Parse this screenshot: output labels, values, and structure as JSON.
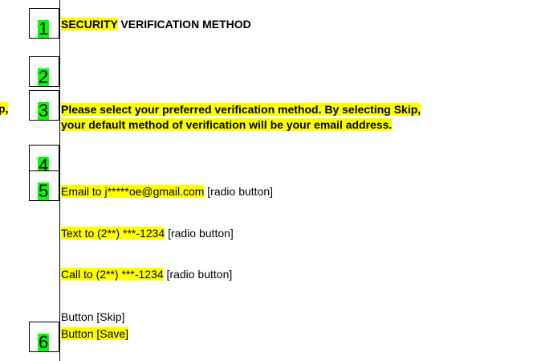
{
  "markers": [
    "1",
    "2",
    "3",
    "4",
    "5",
    "6"
  ],
  "title": {
    "highlighted": "SECURITY",
    "rest": " VERIFICATION METHOD"
  },
  "left_fragment": "p,",
  "instructions": {
    "line1": "Please select your preferred verification method. By selecting Skip,",
    "line2": "your default method of verification will be your email address."
  },
  "options": [
    {
      "label": "Email to j*****oe@gmail.com",
      "note": " [radio button]"
    },
    {
      "label": "Text to (2**) ***-1234",
      "note": " [radio button]"
    },
    {
      "label": "Call to (2**) ***-1234",
      "note": " [radio button]"
    }
  ],
  "buttons": {
    "skip": "Button [Skip]",
    "save": "Button [Save]"
  },
  "colors": {
    "highlight": "#ffff00",
    "marker_fill": "#00ff00"
  }
}
